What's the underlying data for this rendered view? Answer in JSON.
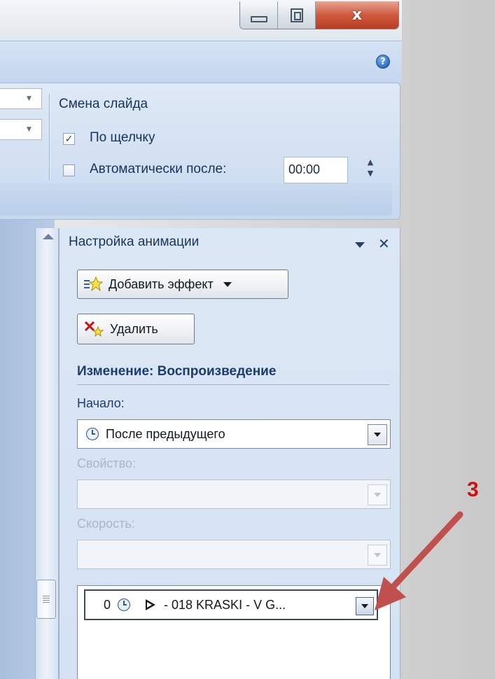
{
  "window": {
    "minimize_glyph": "",
    "close_glyph": "x"
  },
  "ribbon": {
    "help_glyph": "?",
    "slide_transition": {
      "title": "Смена слайда",
      "on_click_label": "По щелчку",
      "on_click_checked": true,
      "auto_after_label": "Автоматически после:",
      "auto_after_checked": false,
      "auto_after_value": "00:00"
    }
  },
  "animation_pane": {
    "title": "Настройка анимации",
    "add_effect_label": "Добавить эффект",
    "remove_label": "Удалить",
    "section_title": "Изменение: Воспроизведение",
    "start_label": "Начало:",
    "start_value": "После предыдущего",
    "property_label": "Свойство:",
    "property_value": "",
    "speed_label": "Скорость:",
    "speed_value": "",
    "effects": [
      {
        "order": "0",
        "name": "- 018 KRASKI - V G..."
      }
    ]
  },
  "annotation": {
    "number": "3",
    "color": "#d01010"
  },
  "icons": {
    "help": "help-icon",
    "add_effect": "star-effect-icon",
    "remove": "remove-effect-icon",
    "start_timing": "clock-icon",
    "play": "play-icon"
  }
}
